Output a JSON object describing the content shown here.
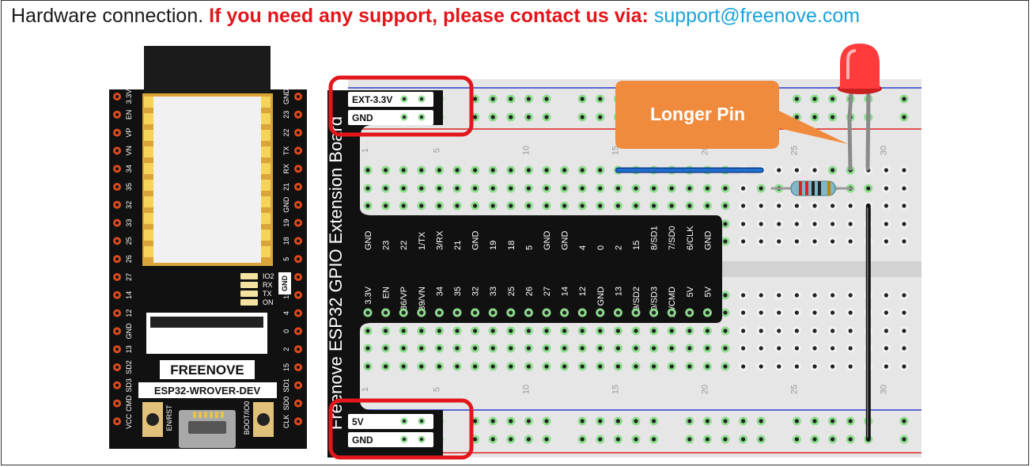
{
  "caption": {
    "prefix": "Hardware connection.",
    "support": "If you need any support, please contact us via:",
    "email": "support@freenove.com"
  },
  "callout": {
    "label": "Longer Pin"
  },
  "esp32": {
    "brand": "FREENOVE",
    "model": "ESP32-WROVER-DEV",
    "left_pins": [
      "3.3V",
      "EN",
      "VP",
      "VN",
      "34",
      "35",
      "32",
      "33",
      "25",
      "26",
      "27",
      "14",
      "12",
      "GND",
      "13",
      "SD2",
      "SD3",
      "CMD",
      "VCC"
    ],
    "right_pins": [
      "GND",
      "23",
      "22",
      "TX",
      "RX",
      "21",
      "GND",
      "19",
      "18",
      "5",
      "17",
      "16",
      "4",
      "0",
      "2",
      "15",
      "SD1",
      "SD0",
      "CLK"
    ],
    "leds": [
      "IO2",
      "RX",
      "TX",
      "ON"
    ],
    "gnd_tag": "GND",
    "buttons": [
      "EN/RST",
      "BOOT/IO0"
    ]
  },
  "extension": {
    "title": "Freenove ESP32 GPIO Extension Board",
    "top_power": [
      "EXT-3.3V",
      "GND"
    ],
    "bottom_power": [
      "5V",
      "GND"
    ],
    "top_row": [
      "GND",
      "23",
      "22",
      "1/TX",
      "3/RX",
      "21",
      "GND",
      "19",
      "18",
      "5",
      "GND",
      "GND",
      "4",
      "0",
      "2",
      "15",
      "8/SD1",
      "7/SD0",
      "6/CLK",
      "GND"
    ],
    "bottom_row": [
      "3.3V",
      "EN",
      "36/VP",
      "39/VN",
      "34",
      "35",
      "32",
      "33",
      "25",
      "26",
      "27",
      "14",
      "12",
      "GND",
      "13",
      "9/SD2",
      "10/SD3",
      "11/CMD",
      "5V",
      "5V"
    ]
  },
  "breadboard": {
    "column_numbers": [
      "1",
      "5",
      "10",
      "15",
      "20",
      "25",
      "30"
    ]
  },
  "colors": {
    "board": "#111111",
    "header": "#e04a1b",
    "highlight_box": "#e3161b",
    "callout": "#f08a3c",
    "jumper": "#1f6fcf",
    "led": "#ff3b3b",
    "hole_active": "#3caa3c"
  },
  "icons": [
    "usb-port-icon",
    "button-icon",
    "led-icon",
    "resistor-icon",
    "wire-icon"
  ]
}
